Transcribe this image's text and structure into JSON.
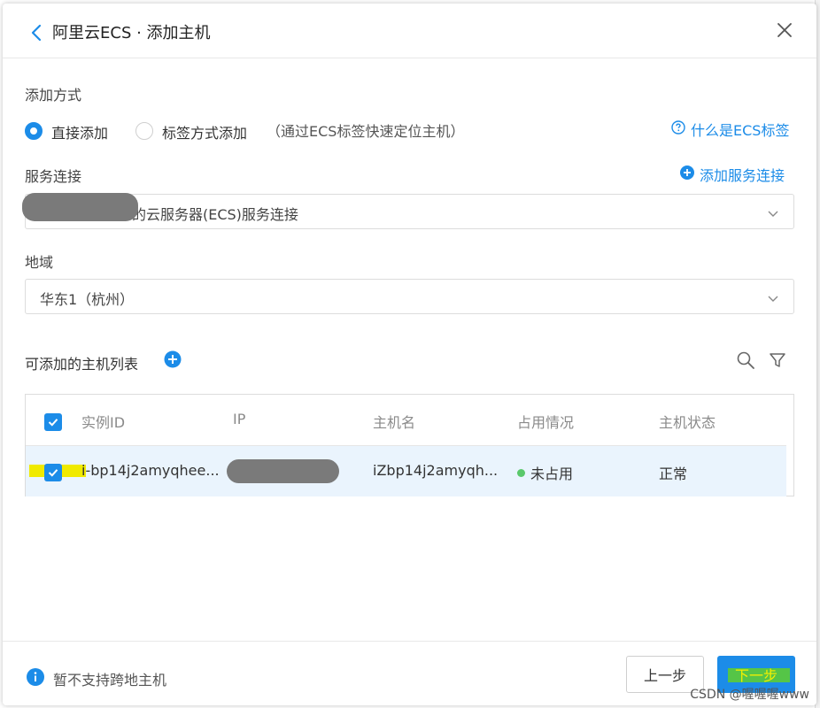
{
  "header": {
    "title": "阿里云ECS · 添加主机"
  },
  "add_method": {
    "label": "添加方式",
    "options": [
      {
        "label": "直接添加",
        "checked": true
      },
      {
        "label": "标签方式添加",
        "checked": false
      }
    ],
    "hint": "（通过ECS标签快速定位主机）",
    "help_link": "什么是ECS标签"
  },
  "service": {
    "label": "服务连接",
    "add_link": "添加服务连接",
    "value": "的云服务器(ECS)服务连接"
  },
  "region": {
    "label": "地域",
    "value": "华东1（杭州）"
  },
  "host_list": {
    "title": "可添加的主机列表",
    "columns": [
      "实例ID",
      "IP",
      "主机名",
      "占用情况",
      "主机状态"
    ],
    "rows": [
      {
        "instance_id": "i-bp14j2amyqhee...",
        "ip": "",
        "hostname": "iZbp14j2amyqh...",
        "usage": "未占用",
        "status": "正常"
      }
    ]
  },
  "footer": {
    "note": "暂不支持跨地主机",
    "prev": "上一步",
    "next": "下一步"
  },
  "watermark": "CSDN @喔喔喔www",
  "colors": {
    "accent": "#1c8ce8",
    "usage_dot": "#5ac86b",
    "highlight": "#f0ea00"
  }
}
